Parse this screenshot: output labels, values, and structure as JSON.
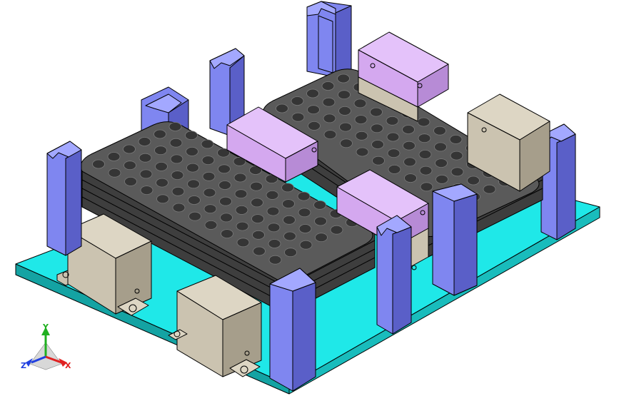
{
  "scene": {
    "background": "#ffffff",
    "colors": {
      "baseplate": "#1fe8e8",
      "baseplate_side": "#19bcbc",
      "baseplate_front": "#14a3a3",
      "tray": "#5a5a5a",
      "tray_side": "#3e3e3e",
      "hole": "#353535",
      "hole_rim": "#7a7a7a",
      "post": "#7f86f0",
      "post_dark": "#5a5fc8",
      "post_light": "#a3a8ff",
      "block_tan": "#cbc3b0",
      "block_tan_side": "#a69e8b",
      "block_tan_top": "#ddd6c4",
      "block_purple": "#d4a8ef",
      "block_purple_side": "#b78bd6",
      "block_purple_top": "#e4c2fa",
      "edge": "#000000"
    },
    "icons": [
      "triad-icon"
    ]
  },
  "triad": {
    "labels": {
      "x": "X",
      "y": "Y",
      "z": "Z"
    },
    "colors": {
      "x": "#e02020",
      "y": "#20b020",
      "z": "#2040e0"
    }
  }
}
